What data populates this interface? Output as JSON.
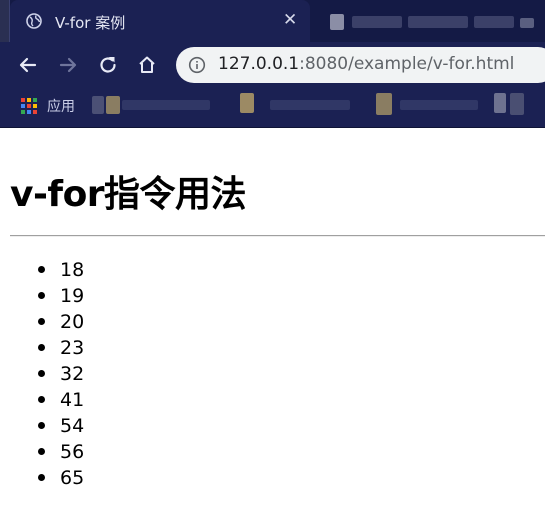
{
  "browser": {
    "tab": {
      "title": "V-for 案例",
      "close_glyph": "✕"
    },
    "address_bar": {
      "host": "127.0.0.1",
      "rest": ":8080/example/v-for.html"
    },
    "bookmarks": {
      "apps_label": "应用"
    }
  },
  "page": {
    "title": "v-for指令用法",
    "items": [
      "18",
      "19",
      "20",
      "23",
      "32",
      "41",
      "54",
      "56",
      "65"
    ]
  }
}
